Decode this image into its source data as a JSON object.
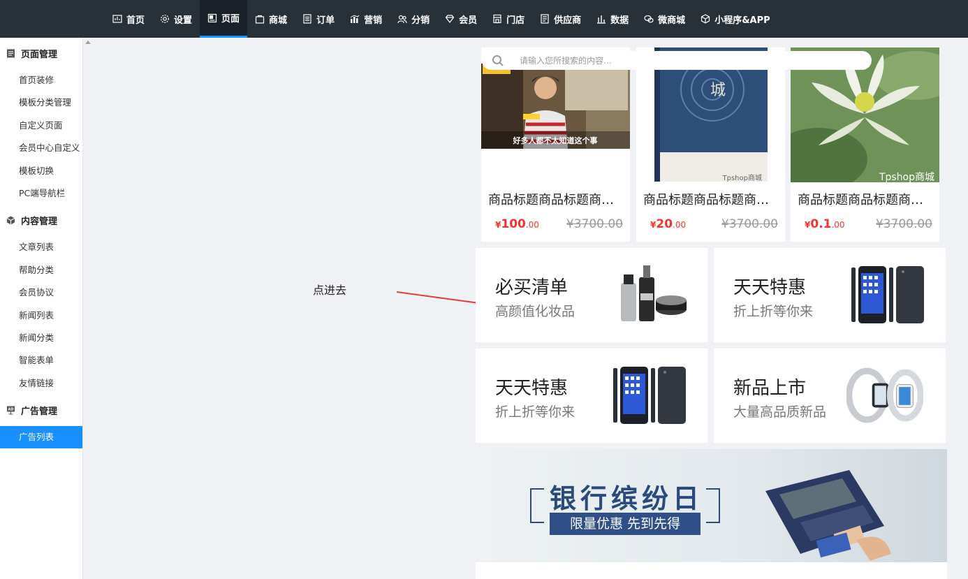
{
  "nav": {
    "items": [
      {
        "label": "首页",
        "icon": "dashboard-icon"
      },
      {
        "label": "设置",
        "icon": "gear-icon"
      },
      {
        "label": "页面",
        "icon": "page-icon",
        "active": true
      },
      {
        "label": "商城",
        "icon": "bag-icon"
      },
      {
        "label": "订单",
        "icon": "order-icon"
      },
      {
        "label": "营销",
        "icon": "chart-icon"
      },
      {
        "label": "分销",
        "icon": "users-icon"
      },
      {
        "label": "会员",
        "icon": "diamond-icon"
      },
      {
        "label": "门店",
        "icon": "store-icon"
      },
      {
        "label": "供应商",
        "icon": "list-icon"
      },
      {
        "label": "数据",
        "icon": "bar-icon"
      },
      {
        "label": "微商城",
        "icon": "wechat-icon"
      },
      {
        "label": "小程序&APP",
        "icon": "cube-icon"
      }
    ]
  },
  "sidebar": {
    "sections": [
      {
        "title": "页面管理",
        "icon": "document-icon",
        "items": [
          "首页装修",
          "模板分类管理",
          "自定义页面",
          "会员中心自定义",
          "模板切换",
          "PC端导航栏"
        ]
      },
      {
        "title": "内容管理",
        "icon": "box-icon",
        "items": [
          "文章列表",
          "帮助分类",
          "会员协议",
          "新闻列表",
          "新闻分类",
          "智能表单",
          "友情链接"
        ]
      },
      {
        "title": "广告管理",
        "icon": "ad-icon",
        "items": [
          "广告列表"
        ]
      }
    ],
    "active_item": "广告列表"
  },
  "annotation": {
    "text": "点进去"
  },
  "preview": {
    "search_placeholder": "请输入您所搜索的内容...",
    "products": [
      {
        "title": "商品标题商品标题商品标题",
        "price_int": "100",
        "price_dec": ".00",
        "currency": "¥",
        "original": "¥3700.00",
        "caption": "好多人都不太知道这个事"
      },
      {
        "title": "商品标题商品标题商品标题",
        "price_int": "20",
        "price_dec": ".00",
        "currency": "¥",
        "original": "¥3700.00",
        "book_text": "城",
        "watermark": "Tpshop商城"
      },
      {
        "title": "商品标题商品标题商品标题",
        "price_int": "0.1",
        "price_dec": ".00",
        "currency": "¥",
        "original": "¥3700.00",
        "watermark": "Tpshop商城"
      }
    ],
    "promos": [
      {
        "heading": "必买清单",
        "sub": "高颜值化妆品"
      },
      {
        "heading": "天天特惠",
        "sub": "折上折等你来"
      },
      {
        "heading": "天天特惠",
        "sub": "折上折等你来"
      },
      {
        "heading": "新品上市",
        "sub": "大量高品质新品"
      }
    ],
    "banner": {
      "title": "银行缤纷日",
      "sub": "限量优惠 先到先得"
    }
  }
}
